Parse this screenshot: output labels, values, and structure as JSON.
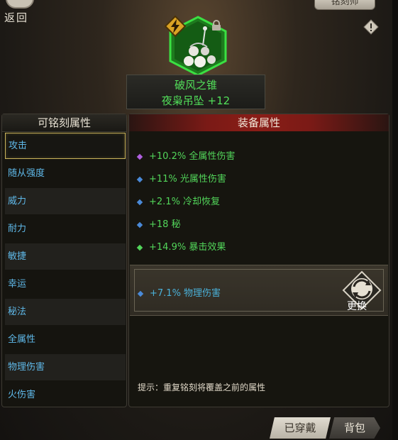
{
  "header": {
    "back_label": "返回",
    "top_right_tab": "铭刻师"
  },
  "item": {
    "name": "破风之锥",
    "subtitle": "夜枭吊坠 +12",
    "icon": "pendant-icon",
    "badge_icon": "lightning-badge-icon",
    "lock_icon": "lock-icon"
  },
  "left_panel": {
    "title": "可铭刻属性",
    "items": [
      {
        "label": "攻击",
        "selected": true
      },
      {
        "label": "随从强度"
      },
      {
        "label": "威力"
      },
      {
        "label": "耐力"
      },
      {
        "label": "敏捷"
      },
      {
        "label": "幸运"
      },
      {
        "label": "秘法"
      },
      {
        "label": "全属性"
      },
      {
        "label": "物理伤害"
      },
      {
        "label": "火伤害"
      }
    ]
  },
  "right_panel": {
    "title": "装备属性",
    "stats": [
      {
        "text": "+10.2% 全属性伤害",
        "dot_color": "#b060e0"
      },
      {
        "text": "+11% 光属性伤害",
        "dot_color": "#4a8ad8"
      },
      {
        "text": "+2.1% 冷却恢复",
        "dot_color": "#4a8ad8"
      },
      {
        "text": "+18 秘",
        "dot_color": "#4a8ad8"
      },
      {
        "text": "+14.9% 暴击效果",
        "dot_color": "#52d55a"
      }
    ],
    "inscribed_stat": "+7.1% 物理伤害",
    "replace_label": "更换",
    "hint": "提示：重复铭刻将覆盖之前的属性"
  },
  "bottom_tabs": {
    "equipped": "已穿戴",
    "bag": "背包"
  },
  "colors": {
    "stat_green": "#52d55a",
    "attr_blue": "#5fb8e8",
    "header_red": "#8a1d17"
  }
}
